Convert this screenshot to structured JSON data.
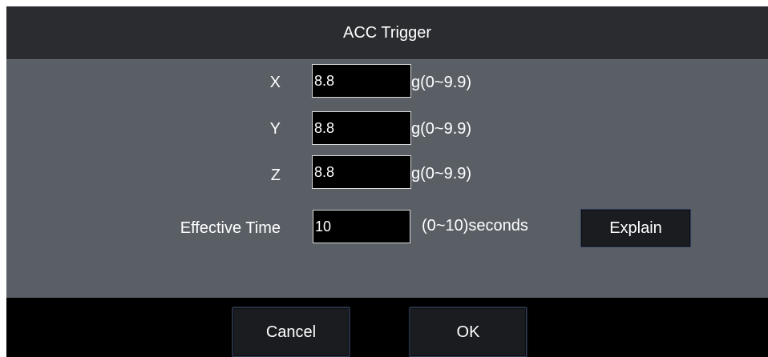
{
  "dialog": {
    "title": "ACC Trigger",
    "rows": [
      {
        "label": "X",
        "value": "8.8",
        "unit": "g(0~9.9)"
      },
      {
        "label": "Y",
        "value": "8.8",
        "unit": "g(0~9.9)"
      },
      {
        "label": "Z",
        "value": "8.8",
        "unit": "g(0~9.9)"
      }
    ],
    "effective_time": {
      "label": "Effective Time",
      "value": "10",
      "unit": "(0~10)seconds",
      "explain_label": "Explain"
    },
    "footer": {
      "cancel_label": "Cancel",
      "ok_label": "OK"
    }
  }
}
